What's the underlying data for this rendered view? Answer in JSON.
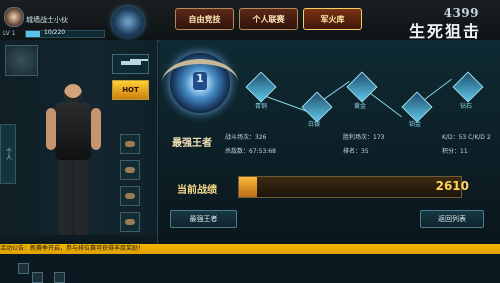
{
  "player": {
    "name": "城墙战士小伙",
    "level": "LV 1",
    "exp_text": "10/220",
    "exp_percent": 18
  },
  "tabs": [
    {
      "label": "自由竞技",
      "active": false
    },
    {
      "label": "个人联赛",
      "active": false
    },
    {
      "label": "军火库",
      "active": true
    }
  ],
  "brand": {
    "site": "4399",
    "title": "生死狙击"
  },
  "sidebar": {
    "tab_label": "个人",
    "hot_label": "HOT"
  },
  "rank": {
    "title": "最强王者",
    "tiers": [
      "青铜",
      "白银",
      "黄金",
      "铂金",
      "钻石"
    ]
  },
  "stats": [
    {
      "label": "战斗场次：",
      "value": "326"
    },
    {
      "label": "胜利场次：",
      "value": "173"
    },
    {
      "label": "K/D：",
      "value": "53 C/K/D 2"
    },
    {
      "label": "杀敌数：",
      "value": "67:53:68"
    },
    {
      "label": "排名：",
      "value": "35"
    },
    {
      "label": "积分：",
      "value": "11"
    }
  ],
  "score": {
    "label": "当前战绩",
    "value": "2610",
    "progress_percent": 8
  },
  "buttons": {
    "left": "最强王者",
    "right": "返回列表"
  },
  "ticker": "活动公告：新赛季开启，参与排位赛可获得丰厚奖励！",
  "colors": {
    "accent": "#f6d88b",
    "blue": "#5cc4e8",
    "gold": "#ffd25b"
  }
}
